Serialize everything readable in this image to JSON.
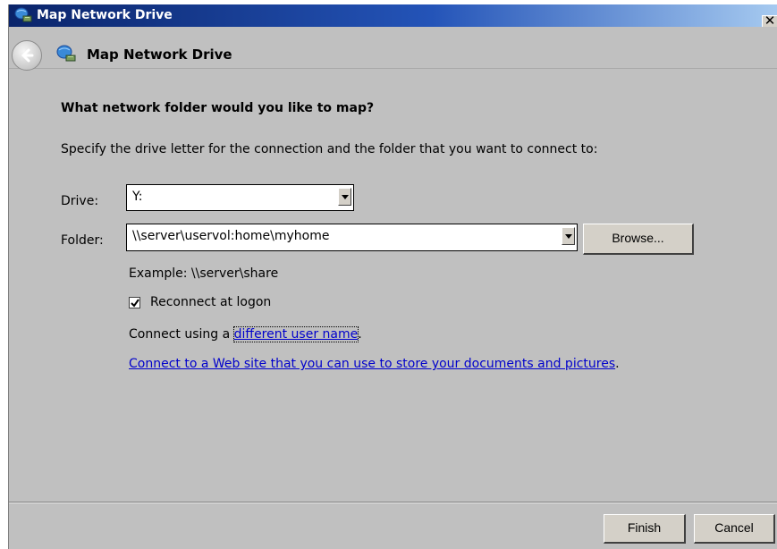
{
  "window": {
    "title": "Map Network Drive",
    "close_glyph": "✕",
    "title_icon": "network-drive-icon"
  },
  "nav": {
    "title": "Map Network Drive",
    "back_icon": "back-arrow-icon"
  },
  "content": {
    "heading": "What network folder would you like to map?",
    "instructions": "Specify the drive letter for the connection and the folder that you want to connect to:",
    "drive": {
      "label": "Drive:",
      "value": "Y:"
    },
    "folder": {
      "label": "Folder:",
      "value": "\\\\server\\uservol:home\\myhome"
    },
    "browse_label": "Browse...",
    "example": "Example: \\\\server\\share",
    "reconnect": {
      "label": "Reconnect at logon",
      "checked": true
    },
    "connect_prefix": "Connect using a ",
    "different_user_link": "different user name",
    "connect_suffix": ".",
    "web_link": "Connect to a Web site that you can use to store your documents and pictures",
    "web_suffix": "."
  },
  "footer": {
    "finish_label": "Finish",
    "cancel_label": "Cancel"
  }
}
